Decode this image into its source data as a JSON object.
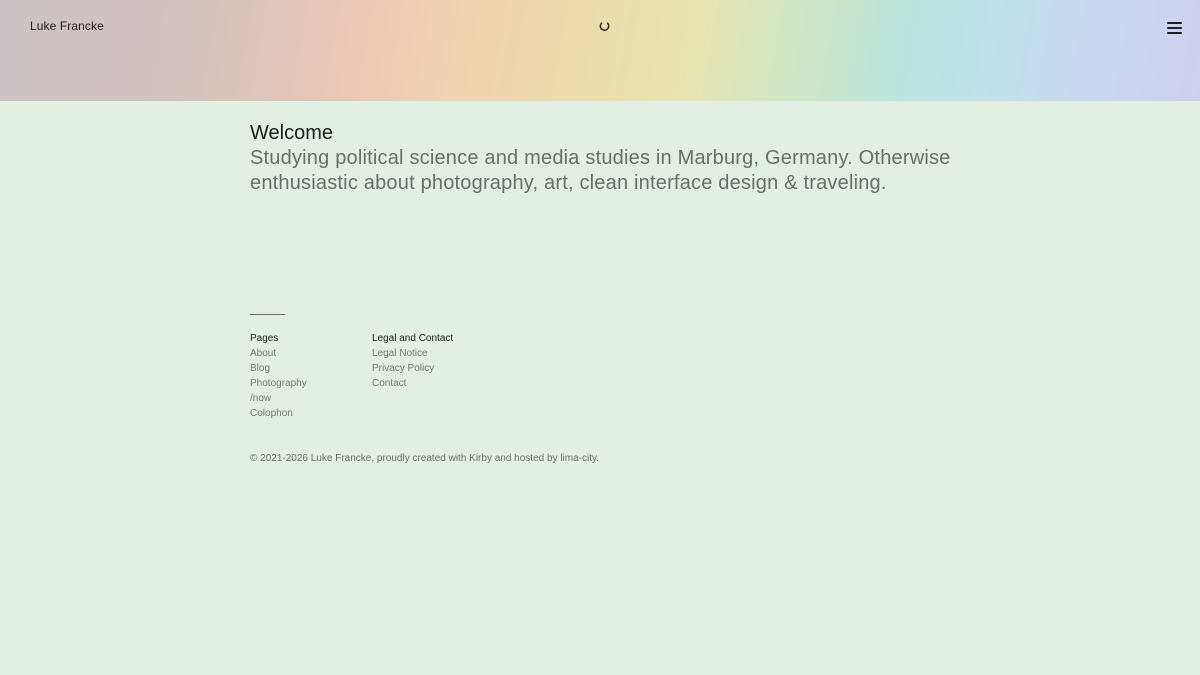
{
  "header": {
    "site_title": "Luke Francke",
    "menu_icon": "hamburger-menu-icon",
    "loading_icon": "loading-spinner-icon"
  },
  "main": {
    "title": "Welcome",
    "intro": "Studying political science and media studies in Marburg, Germany. Otherwise enthusiastic about photography, art, clean interface design & traveling."
  },
  "footer": {
    "pages": {
      "heading": "Pages",
      "links": [
        "About",
        "Blog",
        "Photography",
        "/now",
        "Colophon"
      ]
    },
    "legal": {
      "heading": "Legal and Contact",
      "links": [
        "Legal Notice",
        "Privacy Policy",
        "Contact"
      ]
    },
    "copyright": "© 2021-2026 Luke Francke, proudly created with Kirby and hosted by lima-city."
  }
}
